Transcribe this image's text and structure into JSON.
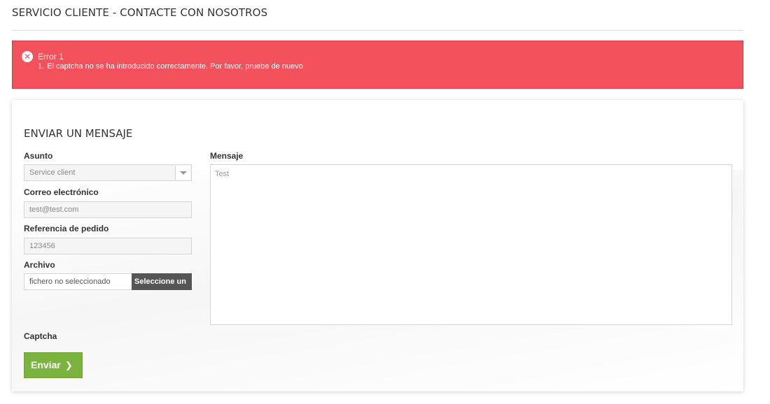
{
  "page": {
    "title": "SERVICIO CLIENTE - CONTACTE CON NOSOTROS"
  },
  "alert": {
    "title": "Error 1",
    "number": "1.",
    "message": "El captcha no se ha introducido correctamente. Por favor, pruebe de nuevo",
    "icon": "close-circle-icon",
    "color": "#f3515c"
  },
  "form": {
    "heading": "ENVIAR UN MENSAJE",
    "subject": {
      "label": "Asunto",
      "value": "Service client"
    },
    "email": {
      "label": "Correo electrónico",
      "value": "test@test.com"
    },
    "order": {
      "label": "Referencia de pedido",
      "value": "123456"
    },
    "file": {
      "label": "Archivo",
      "filename": "fichero no seleccionado",
      "button": "Seleccione un"
    },
    "message": {
      "label": "Mensaje",
      "value": "Test"
    },
    "captcha": {
      "label": "Captcha"
    },
    "submit": {
      "label": "Enviar",
      "icon": "chevron-right-icon",
      "color": "#7ab33e"
    }
  }
}
